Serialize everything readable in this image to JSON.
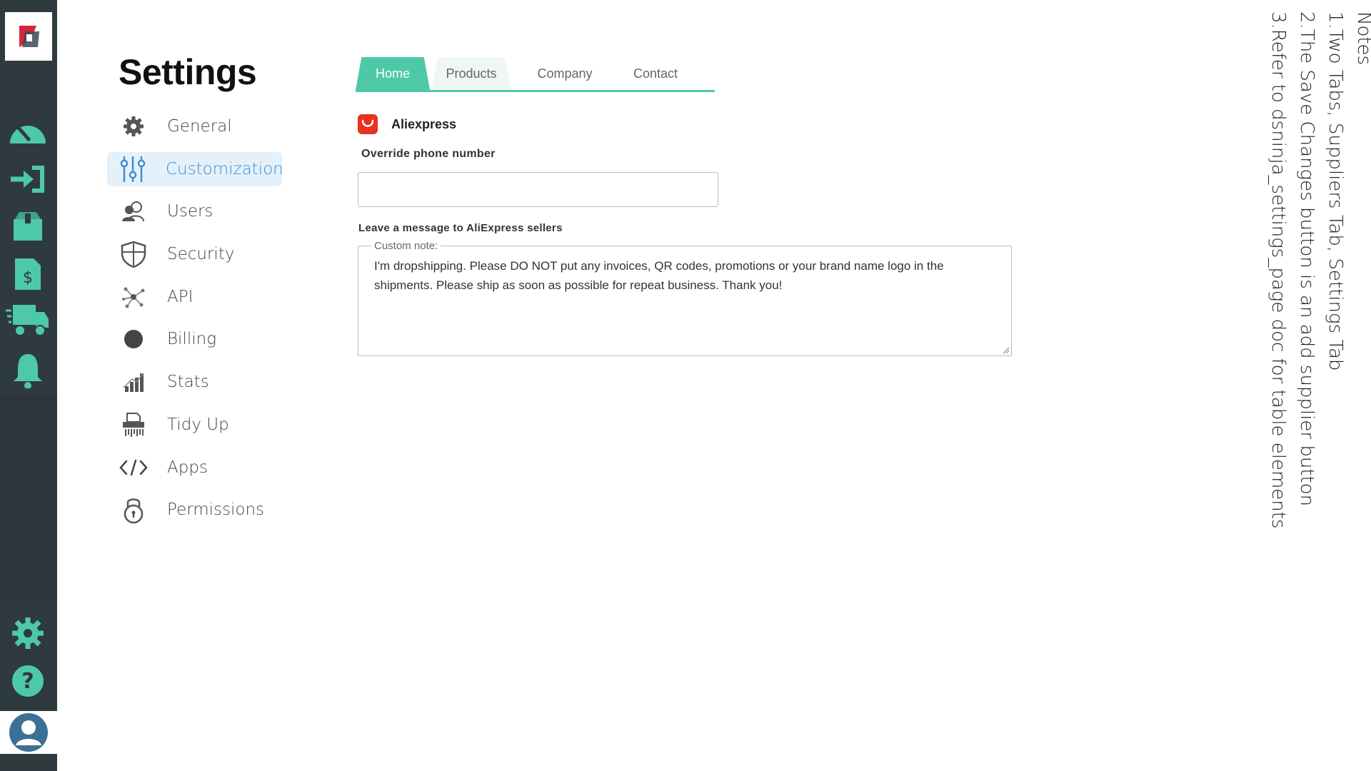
{
  "sidebar_rail": {
    "logo": "app-logo",
    "icons": [
      "dashboard-icon",
      "import-icon",
      "box-icon",
      "invoice-icon",
      "truck-icon",
      "bell-icon",
      "gear-icon",
      "help-icon",
      "user-icon"
    ]
  },
  "page": {
    "title": "Settings"
  },
  "menu": {
    "items": [
      {
        "label": "General",
        "icon": "gear-icon"
      },
      {
        "label": "Customization",
        "icon": "sliders-icon",
        "active": true
      },
      {
        "label": "Users",
        "icon": "users-icon"
      },
      {
        "label": "Security",
        "icon": "shield-icon"
      },
      {
        "label": "API",
        "icon": "nodes-icon"
      },
      {
        "label": "Billing",
        "icon": "circle-icon"
      },
      {
        "label": "Stats",
        "icon": "chart-icon"
      },
      {
        "label": "Tidy Up",
        "icon": "shredder-icon"
      },
      {
        "label": "Apps",
        "icon": "code-icon"
      },
      {
        "label": "Permissions",
        "icon": "lock-icon"
      }
    ]
  },
  "tabs": {
    "home": "Home",
    "products": "Products",
    "company": "Company",
    "contact": "Contact"
  },
  "supplier": {
    "name": "Aliexpress",
    "icon": "aliexpress-icon"
  },
  "form": {
    "phone_label": "Override phone number",
    "phone_value": "",
    "message_label": "Leave a message to AliExpress sellers",
    "note_legend": "Custom note:",
    "note_value": "I'm dropshipping. Please DO NOT put any invoices, QR codes, promotions or your brand name logo in the shipments. Please ship as soon as possible for repeat business. Thank you!"
  },
  "notes": {
    "heading": "Notes",
    "lines": [
      "1.Two Tabs, Suppliers Tab, Settings Tab",
      "2.The Save Changes button is an add supplier button",
      "3.Refer to dsninja_settings_page doc for table elements"
    ]
  },
  "colors": {
    "rail": "#2f3a3f",
    "accent": "#4dc9a8",
    "active_bg": "#e4f1fb",
    "active_text": "#3d8fd1",
    "aliexpress": "#e8321e"
  }
}
